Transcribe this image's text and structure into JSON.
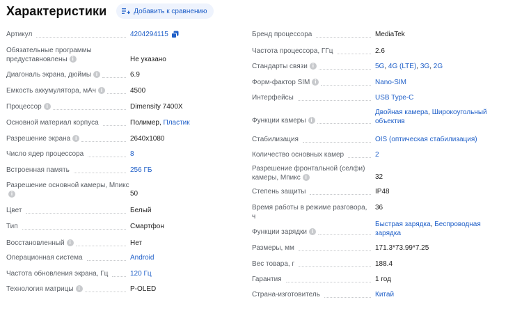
{
  "header": {
    "title": "Характеристики",
    "compare_label": "Добавить к сравнению"
  },
  "left": [
    {
      "label": "Артикул",
      "value": "4204294115",
      "link": true,
      "copy": true
    },
    {
      "label": "Обязательные программы предуставновлены",
      "info": true,
      "value": "Не указано"
    },
    {
      "label": "Диагональ экрана, дюймы",
      "info": true,
      "value": "6.9"
    },
    {
      "label": "Емкость аккумулятора, мАч",
      "info": true,
      "value": "4500"
    },
    {
      "label": "Процессор",
      "info": true,
      "value": "Dimensity 7400X"
    },
    {
      "label": "Основной материал корпуса",
      "value_parts": [
        {
          "text": "Полимер",
          "link": false
        },
        {
          "text": ", ",
          "link": false
        },
        {
          "text": "Пластик",
          "link": true
        }
      ]
    },
    {
      "label": "Разрешение экрана",
      "info": true,
      "value": "2640x1080"
    },
    {
      "label": "Число ядер процессора",
      "value": "8",
      "link": true
    },
    {
      "label": "Встроенная память",
      "value": "256 ГБ",
      "link": true
    },
    {
      "label": "Разрешение основной камеры, Мпикс",
      "info": true,
      "value": "50"
    },
    {
      "label": "Цвет",
      "value": "Белый"
    },
    {
      "label": "Тип",
      "value": "Смартфон"
    },
    {
      "label": "Восстановленный",
      "info": true,
      "value": "Нет"
    },
    {
      "label": "Операционная система",
      "value": "Android",
      "link": true
    },
    {
      "label": "Частота обновления экрана, Гц",
      "value": "120 Гц",
      "link": true
    },
    {
      "label": "Технология матрицы",
      "info": true,
      "value": "P-OLED"
    }
  ],
  "right": [
    {
      "label": "Бренд процессора",
      "value": "MediaTek"
    },
    {
      "label": "Частота процессора, ГГц",
      "value": "2.6"
    },
    {
      "label": "Стандарты связи",
      "info": true,
      "value_parts": [
        {
          "text": "5G",
          "link": true
        },
        {
          "text": ", ",
          "link": false
        },
        {
          "text": "4G (LTE)",
          "link": true
        },
        {
          "text": ", ",
          "link": false
        },
        {
          "text": "3G",
          "link": true
        },
        {
          "text": ", ",
          "link": false
        },
        {
          "text": "2G",
          "link": true
        }
      ]
    },
    {
      "label": "Форм-фактор SIM",
      "info": true,
      "value": "Nano-SIM",
      "link": true
    },
    {
      "label": "Интерфейсы",
      "value": "USB Type-C",
      "link": true
    },
    {
      "label": "Функции камеры",
      "info": true,
      "value_parts": [
        {
          "text": "Двойная камера",
          "link": true
        },
        {
          "text": ", ",
          "link": false
        },
        {
          "text": "Широкоугольный объектив",
          "link": true
        }
      ]
    },
    {
      "label": "Стабилизация",
      "value": "OIS (оптическая стабилизация)",
      "link": true
    },
    {
      "label": "Количество основных камер",
      "value": "2",
      "link": true
    },
    {
      "label": "Разрешение фронтальной (селфи) камеры, Мпикс",
      "info": true,
      "value": "32"
    },
    {
      "label": "Степень защиты",
      "value": "IP48"
    },
    {
      "label": "Время работы в режиме разговора, ч",
      "value": "36"
    },
    {
      "label": "Функции зарядки",
      "info": true,
      "value_parts": [
        {
          "text": "Быстрая зарядка",
          "link": true
        },
        {
          "text": ", ",
          "link": false
        },
        {
          "text": "Беспроводная зарядка",
          "link": true
        }
      ]
    },
    {
      "label": "Размеры, мм",
      "value": "171.3*73.99*7.25"
    },
    {
      "label": "Вес товара, г",
      "value": "188.4"
    },
    {
      "label": "Гарантия",
      "value": "1 год"
    },
    {
      "label": "Страна-изготовитель",
      "value": "Китай",
      "link": true
    }
  ]
}
